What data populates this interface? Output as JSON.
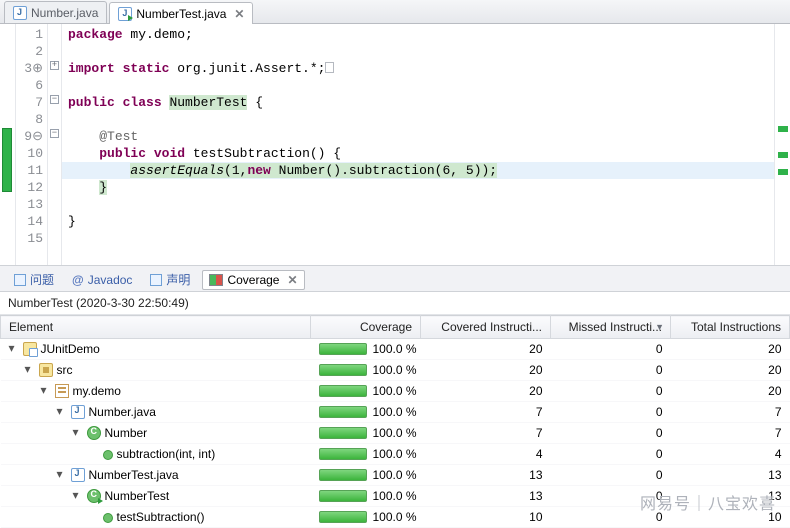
{
  "editor_tabs": {
    "inactive": "Number.java",
    "active": "NumberTest.java"
  },
  "code": {
    "lines": [
      {
        "n": "1"
      },
      {
        "n": "2"
      },
      {
        "n": "3"
      },
      {
        "n": "6"
      },
      {
        "n": "7"
      },
      {
        "n": "8"
      },
      {
        "n": "9"
      },
      {
        "n": "10"
      },
      {
        "n": "11"
      },
      {
        "n": "12"
      },
      {
        "n": "13"
      },
      {
        "n": "14"
      },
      {
        "n": "15"
      }
    ],
    "line1_kw1": "package",
    "line1_kw2": " my.demo;",
    "line3_kw1": "import",
    "line3_kw2": "static",
    "line3_txt": " org.junit.Assert.*;",
    "line7_kw1": "public",
    "line7_kw2": "class",
    "line7_name": "NumberTest",
    "line7_brace": " {",
    "line9_ann": "@Test",
    "line10_kw1": "public",
    "line10_kw2": "void",
    "line10_name": " testSubtraction() {",
    "line11_fn": "assertEquals",
    "line11_args": "(1,",
    "line11_kw": "new",
    "line11_rest": " Number().subtraction(6, 5));",
    "line12_brace": "}",
    "line14_brace": "}"
  },
  "bottom_tabs": {
    "problems": "问题",
    "javadoc": "Javadoc",
    "declaration": "声明",
    "coverage": "Coverage"
  },
  "coverage_heading": "NumberTest (2020-3-30 22:50:49)",
  "columns": {
    "element": "Element",
    "coverage": "Coverage",
    "covered": "Covered Instructi...",
    "missed": "Missed Instructi...",
    "total": "Total Instructions"
  },
  "rows": [
    {
      "indent": 0,
      "tw": "▾",
      "icon": "proj",
      "name": "JUnitDemo",
      "cov": "100.0 %",
      "c": "20",
      "m": "0",
      "t": "20"
    },
    {
      "indent": 1,
      "tw": "▾",
      "icon": "src",
      "name": "src",
      "cov": "100.0 %",
      "c": "20",
      "m": "0",
      "t": "20"
    },
    {
      "indent": 2,
      "tw": "▾",
      "icon": "pkg",
      "name": "my.demo",
      "cov": "100.0 %",
      "c": "20",
      "m": "0",
      "t": "20"
    },
    {
      "indent": 3,
      "tw": "▾",
      "icon": "jf",
      "name": "Number.java",
      "cov": "100.0 %",
      "c": "7",
      "m": "0",
      "t": "7"
    },
    {
      "indent": 4,
      "tw": "▾",
      "icon": "cls",
      "name": "Number",
      "cov": "100.0 %",
      "c": "7",
      "m": "0",
      "t": "7"
    },
    {
      "indent": 5,
      "tw": "",
      "icon": "mth",
      "name": "subtraction(int, int)",
      "cov": "100.0 %",
      "c": "4",
      "m": "0",
      "t": "4"
    },
    {
      "indent": 3,
      "tw": "▾",
      "icon": "jf",
      "iconrun": true,
      "name": "NumberTest.java",
      "cov": "100.0 %",
      "c": "13",
      "m": "0",
      "t": "13"
    },
    {
      "indent": 4,
      "tw": "▾",
      "icon": "cls",
      "iconrun": true,
      "name": "NumberTest",
      "cov": "100.0 %",
      "c": "13",
      "m": "0",
      "t": "13"
    },
    {
      "indent": 5,
      "tw": "",
      "icon": "mth",
      "name": "testSubtraction()",
      "cov": "100.0 %",
      "c": "10",
      "m": "0",
      "t": "10"
    }
  ],
  "watermark": "网易号｜八宝欢喜"
}
